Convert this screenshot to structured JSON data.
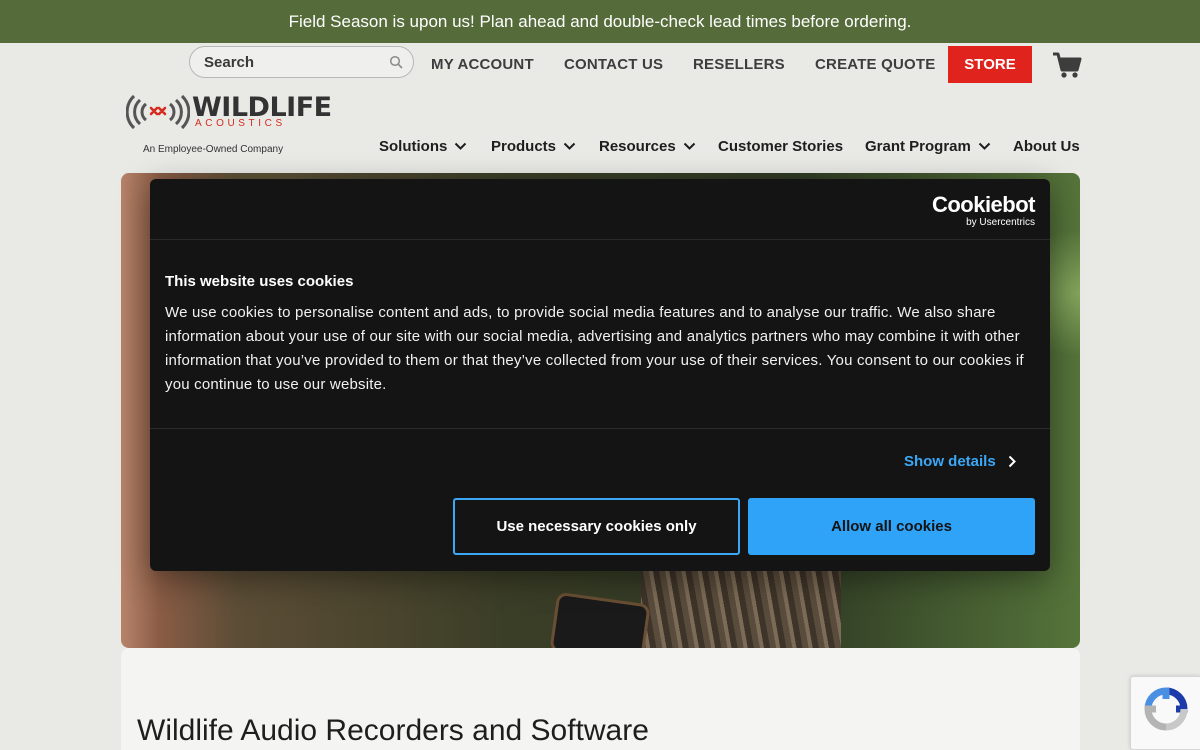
{
  "banner": {
    "text": "Field Season is upon us! Plan ahead and double-check lead times before ordering."
  },
  "utility_nav": {
    "search_placeholder": "Search",
    "my_account": "MY ACCOUNT",
    "contact_us": "CONTACT US",
    "resellers": "RESELLERS",
    "create_quote": "CREATE QUOTE",
    "store": "STORE",
    "cart_icon": "shopping-cart-icon"
  },
  "logo": {
    "word": "WILDLIFE",
    "sub": "ACOUSTICS",
    "tagline": "An Employee-Owned Company"
  },
  "main_nav": [
    {
      "label": "Solutions",
      "dropdown": true
    },
    {
      "label": "Products",
      "dropdown": true
    },
    {
      "label": "Resources",
      "dropdown": true
    },
    {
      "label": "Customer Stories",
      "dropdown": false
    },
    {
      "label": "Grant Program",
      "dropdown": true
    },
    {
      "label": "About Us",
      "dropdown": false
    }
  ],
  "cookie_dialog": {
    "brand": "Cookiebot",
    "brand_sub": "by Usercentrics",
    "title": "This website uses cookies",
    "body": "We use cookies to personalise content and ads, to provide social media features and to analyse our traffic. We also share information about your use of our site with our social media, advertising and analytics partners who may combine it with other information that you’ve provided to them or that they’ve collected from your use of their services. You consent to our cookies if you continue to use our website.",
    "show_details": "Show details",
    "necessary_button": "Use necessary cookies only",
    "allow_all_button": "Allow all cookies"
  },
  "page": {
    "heading": "Wildlife Audio Recorders and Software"
  },
  "colors": {
    "banner": "#556b3a",
    "store": "#e0231c",
    "accent_blue": "#2ea3f8",
    "dialog": "#141414"
  }
}
